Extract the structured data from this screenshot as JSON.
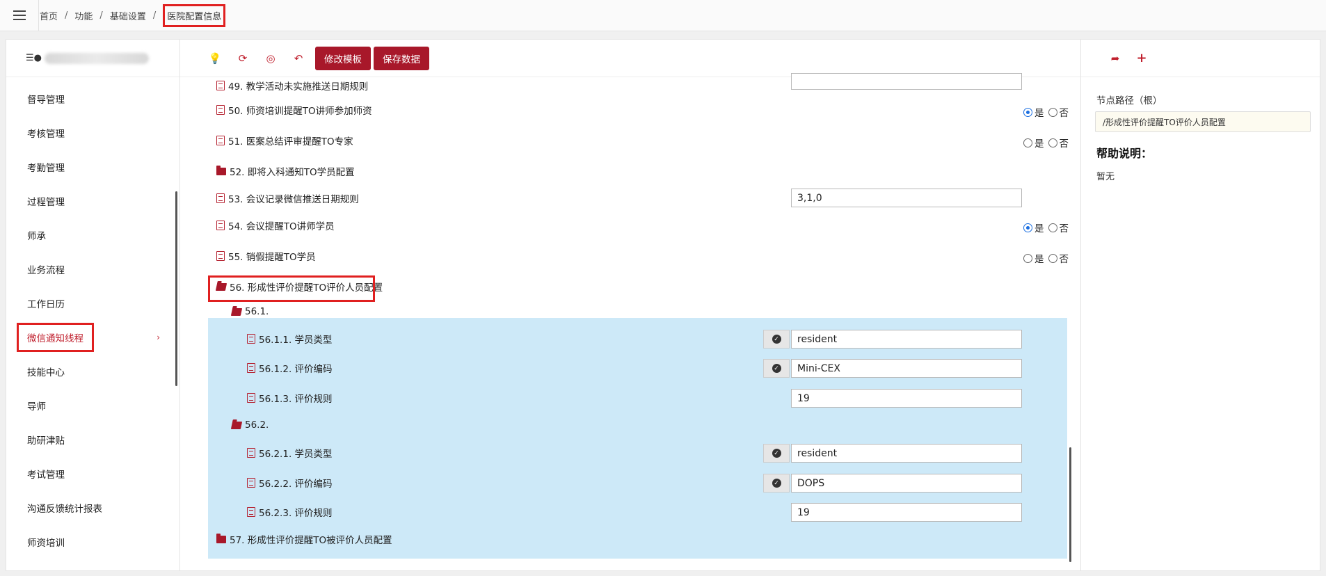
{
  "breadcrumb": [
    "首页",
    "功能",
    "基础设置",
    "医院配置信息"
  ],
  "sidebar": {
    "items": [
      "督导管理",
      "考核管理",
      "考勤管理",
      "过程管理",
      "师承",
      "业务流程",
      "工作日历",
      "微信通知线程",
      "技能中心",
      "导师",
      "助研津贴",
      "考试管理",
      "沟通反馈统计报表",
      "师资培训"
    ],
    "active_index": 7
  },
  "toolbar": {
    "edit_template": "修改模板",
    "save_data": "保存数据"
  },
  "tree": {
    "r49": "49. 教学活动未实施推送日期规则",
    "r50": "50. 师资培训提醒TO讲师参加师资",
    "r51": "51. 医案总结评审提醒TO专家",
    "r52": "52. 即将入科通知TO学员配置",
    "r53": "53. 会议记录微信推送日期规则",
    "r53_value": "3,1,0",
    "r54": "54. 会议提醒TO讲师学员",
    "r55": "55. 销假提醒TO学员",
    "r56": "56. 形成性评价提醒TO评价人员配置",
    "r56_1": "56.1.",
    "r56_1_1": "56.1.1. 学员类型",
    "r56_1_1_value": "resident",
    "r56_1_2": "56.1.2. 评价编码",
    "r56_1_2_value": "Mini-CEX",
    "r56_1_3": "56.1.3. 评价规则",
    "r56_1_3_value": "19",
    "r56_2": "56.2.",
    "r56_2_1": "56.2.1. 学员类型",
    "r56_2_1_value": "resident",
    "r56_2_2": "56.2.2. 评价编码",
    "r56_2_2_value": "DOPS",
    "r56_2_3": "56.2.3. 评价规则",
    "r56_2_3_value": "19",
    "r57": "57. 形成性评价提醒TO被评价人员配置",
    "yes": "是",
    "no": "否"
  },
  "right_panel": {
    "node_path_label": "节点路径（根）",
    "node_path_value": "/形成性评价提醒TO评价人员配置",
    "help_title": "帮助说明：",
    "help_text": "暂无"
  }
}
